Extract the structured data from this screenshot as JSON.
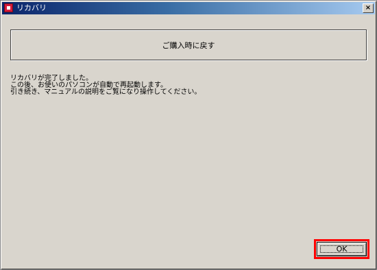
{
  "window": {
    "title": "リカバリ"
  },
  "main": {
    "restore_button_label": "ご購入時に戻す",
    "message_lines": [
      "リカバリが完了しました。",
      "この後、お使いのパソコンが自動で再起動します。",
      "引き続き、マニュアルの説明をご覧になり操作してください。"
    ]
  },
  "footer": {
    "ok_label": "OK"
  },
  "colors": {
    "highlight": "#ff0000",
    "title_bar": "#0a246a"
  }
}
